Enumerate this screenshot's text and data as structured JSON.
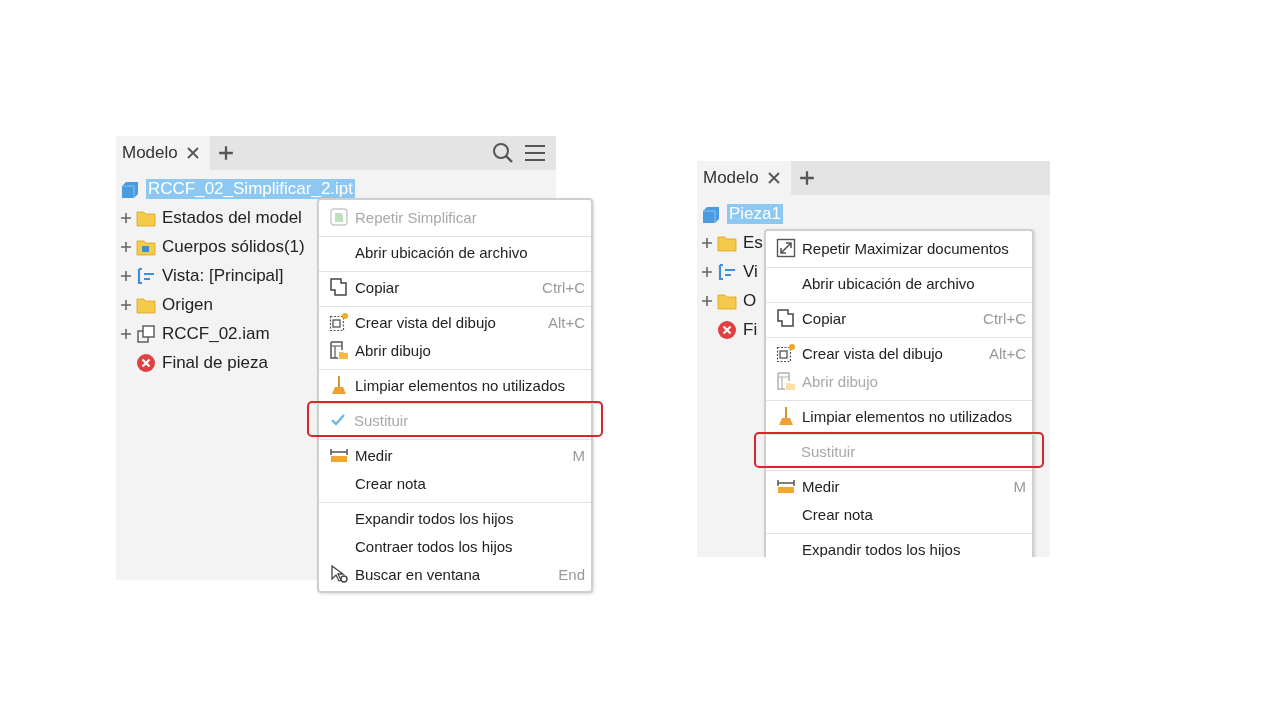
{
  "panels": [
    {
      "tab": {
        "label": "Modelo"
      },
      "tools": [
        {
          "kind": "search"
        },
        {
          "kind": "menu"
        }
      ],
      "tree": {
        "label": "RCCF_02_Simplificar_2.ipt",
        "selected": true,
        "children": [
          {
            "label": "Estados del model",
            "kind": "folder",
            "expandable": true
          },
          {
            "label": "Cuerpos sólidos(1)",
            "kind": "solids",
            "expandable": true
          },
          {
            "label": "Vista: [Principal]",
            "kind": "view",
            "expandable": true
          },
          {
            "label": "Origen",
            "kind": "folder",
            "expandable": true
          },
          {
            "label": "RCCF_02.iam",
            "kind": "assembly",
            "expandable": true
          },
          {
            "label": "Final de pieza",
            "kind": "end",
            "expandable": false
          }
        ]
      },
      "menu": [
        {
          "label": "Repetir Simplificar",
          "kind": "repeat",
          "disabled": true,
          "checked": false,
          "divider": false,
          "highlighted": false
        },
        {
          "label": "Abrir ubicación de archivo",
          "kind": "none",
          "disabled": false,
          "checked": false,
          "divider": true,
          "highlighted": false
        },
        {
          "label": "Copiar",
          "shortcut": "Ctrl+C",
          "kind": "copy",
          "disabled": false,
          "checked": false,
          "divider": true,
          "highlighted": false
        },
        {
          "label": "Crear vista del dibujo",
          "shortcut": "Alt+C",
          "kind": "view",
          "disabled": false,
          "checked": false,
          "divider": true,
          "highlighted": false
        },
        {
          "label": "Abrir dibujo",
          "kind": "drawing",
          "disabled": false,
          "checked": false,
          "divider": false,
          "highlighted": false
        },
        {
          "label": "Limpiar elementos no utilizados",
          "kind": "broom",
          "disabled": false,
          "checked": false,
          "divider": true,
          "highlighted": false
        },
        {
          "label": "Sustituir",
          "kind": "none",
          "disabled": true,
          "checked": true,
          "divider": true,
          "highlighted": true
        },
        {
          "label": "Medir",
          "shortcut": "M",
          "kind": "ruler",
          "disabled": false,
          "checked": false,
          "divider": true,
          "highlighted": false
        },
        {
          "label": "Crear nota",
          "kind": "none",
          "disabled": false,
          "checked": false,
          "divider": false,
          "highlighted": false
        },
        {
          "label": "Expandir todos los hijos",
          "kind": "none",
          "disabled": false,
          "checked": false,
          "divider": true,
          "highlighted": false
        },
        {
          "label": "Contraer todos los hijos",
          "kind": "none",
          "disabled": false,
          "checked": false,
          "divider": false,
          "highlighted": false
        },
        {
          "label": "Buscar en ventana",
          "shortcut": "End",
          "kind": "find",
          "disabled": false,
          "checked": false,
          "divider": false,
          "highlighted": false
        }
      ]
    },
    {
      "tab": {
        "label": "Modelo"
      },
      "tree": {
        "label": "Pieza1",
        "selected": true,
        "children": [
          {
            "label": "Es",
            "kind": "folder",
            "expandable": true
          },
          {
            "label": "Vi",
            "kind": "view",
            "expandable": true
          },
          {
            "label": "O",
            "kind": "folder",
            "expandable": true
          },
          {
            "label": "Fi",
            "kind": "end",
            "expandable": false
          }
        ]
      },
      "menu": [
        {
          "label": "Repetir Maximizar documentos",
          "kind": "resize",
          "disabled": false,
          "checked": false,
          "divider": false,
          "highlighted": false
        },
        {
          "label": "Abrir ubicación de archivo",
          "kind": "none",
          "disabled": false,
          "checked": false,
          "divider": true,
          "highlighted": false
        },
        {
          "label": "Copiar",
          "shortcut": "Ctrl+C",
          "kind": "copy",
          "disabled": false,
          "checked": false,
          "divider": true,
          "highlighted": false
        },
        {
          "label": "Crear vista del dibujo",
          "shortcut": "Alt+C",
          "kind": "view",
          "disabled": false,
          "checked": false,
          "divider": true,
          "highlighted": false
        },
        {
          "label": "Abrir dibujo",
          "kind": "drawing",
          "disabled": true,
          "checked": false,
          "divider": false,
          "highlighted": false
        },
        {
          "label": "Limpiar elementos no utilizados",
          "kind": "broom",
          "disabled": false,
          "checked": false,
          "divider": true,
          "highlighted": false
        },
        {
          "label": "Sustituir",
          "kind": "none",
          "disabled": true,
          "checked": false,
          "divider": true,
          "highlighted": true
        },
        {
          "label": "Medir",
          "shortcut": "M",
          "kind": "ruler",
          "disabled": false,
          "checked": false,
          "divider": true,
          "highlighted": false
        },
        {
          "label": "Crear nota",
          "kind": "none",
          "disabled": false,
          "checked": false,
          "divider": false,
          "highlighted": false
        },
        {
          "label": "Expandir todos los hijos",
          "kind": "none",
          "disabled": false,
          "checked": false,
          "divider": true,
          "highlighted": false
        }
      ]
    }
  ]
}
